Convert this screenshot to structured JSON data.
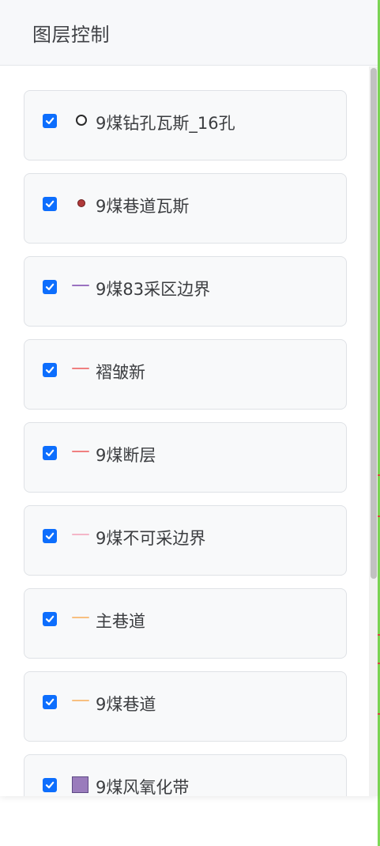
{
  "panel": {
    "title": "图层控制"
  },
  "layers": [
    {
      "label": "9煤钻孔瓦斯_16孔",
      "checked": true,
      "symbol": "circle-ring-icon",
      "color": "#2a2a2a"
    },
    {
      "label": "9煤巷道瓦斯",
      "checked": true,
      "symbol": "circle-dot-icon",
      "color": "#b03a3a"
    },
    {
      "label": "9煤83采区边界",
      "checked": true,
      "symbol": "line-icon",
      "color": "#9b72c0"
    },
    {
      "label": "褶皱新",
      "checked": true,
      "symbol": "line-icon",
      "color": "#f08080"
    },
    {
      "label": "9煤断层",
      "checked": true,
      "symbol": "line-icon",
      "color": "#f08080"
    },
    {
      "label": "9煤不可采边界",
      "checked": true,
      "symbol": "line-icon",
      "color": "#f4b6c8"
    },
    {
      "label": "主巷道",
      "checked": true,
      "symbol": "line-icon",
      "color": "#f8c080"
    },
    {
      "label": "9煤巷道",
      "checked": true,
      "symbol": "line-icon",
      "color": "#f8c080"
    },
    {
      "label": "9煤风氧化带",
      "checked": true,
      "symbol": "fill-square-icon",
      "color": "#9a7cbc"
    }
  ],
  "colors": {
    "checkbox": "#0d6efd",
    "map_edge": "#7ed957"
  }
}
